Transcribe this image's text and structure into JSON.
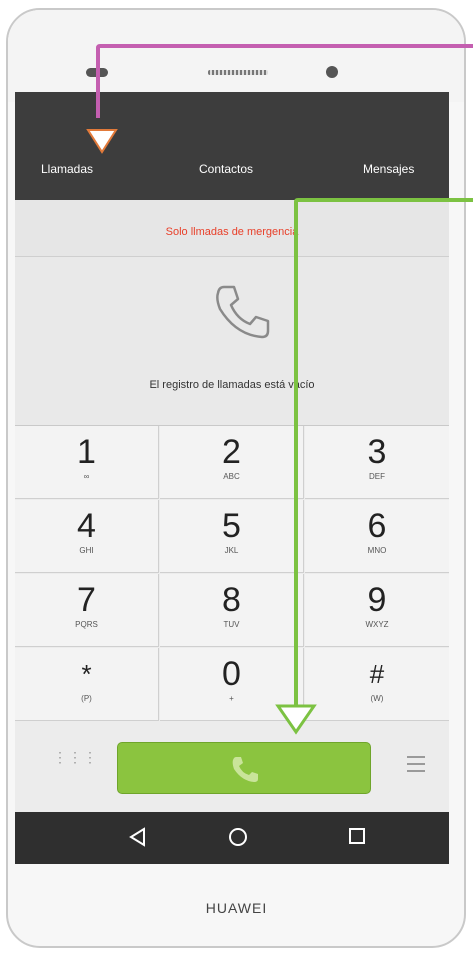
{
  "tabs": [
    "Llamadas",
    "Contactos",
    "Mensajes"
  ],
  "emergency_text": "Solo llmadas de mergencia",
  "log_empty_text": "El registro de llamadas está vacío",
  "keypad": [
    {
      "digit": "1",
      "letters": "∞"
    },
    {
      "digit": "2",
      "letters": "ABC"
    },
    {
      "digit": "3",
      "letters": "DEF"
    },
    {
      "digit": "4",
      "letters": "GHI"
    },
    {
      "digit": "5",
      "letters": "JKL"
    },
    {
      "digit": "6",
      "letters": "MNO"
    },
    {
      "digit": "7",
      "letters": "PQRS"
    },
    {
      "digit": "8",
      "letters": "TUV"
    },
    {
      "digit": "9",
      "letters": "WXYZ"
    },
    {
      "digit": "*",
      "letters": "(P)"
    },
    {
      "digit": "0",
      "letters": "+"
    },
    {
      "digit": "#",
      "letters": "(W)"
    }
  ],
  "brand": "HUAWEI",
  "colors": {
    "call_button": "#8bc43f",
    "emergency_text": "#e8402a",
    "annotation_pink": "#c45fb0",
    "annotation_orange": "#e27a3a",
    "annotation_green": "#7cc242"
  },
  "icons": {
    "log": "phone-outline-icon",
    "call": "phone-handset-icon",
    "dialpad": "dialpad-icon",
    "menu": "menu-icon",
    "back": "back-triangle-icon",
    "home": "home-circle-icon",
    "recent": "recent-square-icon"
  }
}
